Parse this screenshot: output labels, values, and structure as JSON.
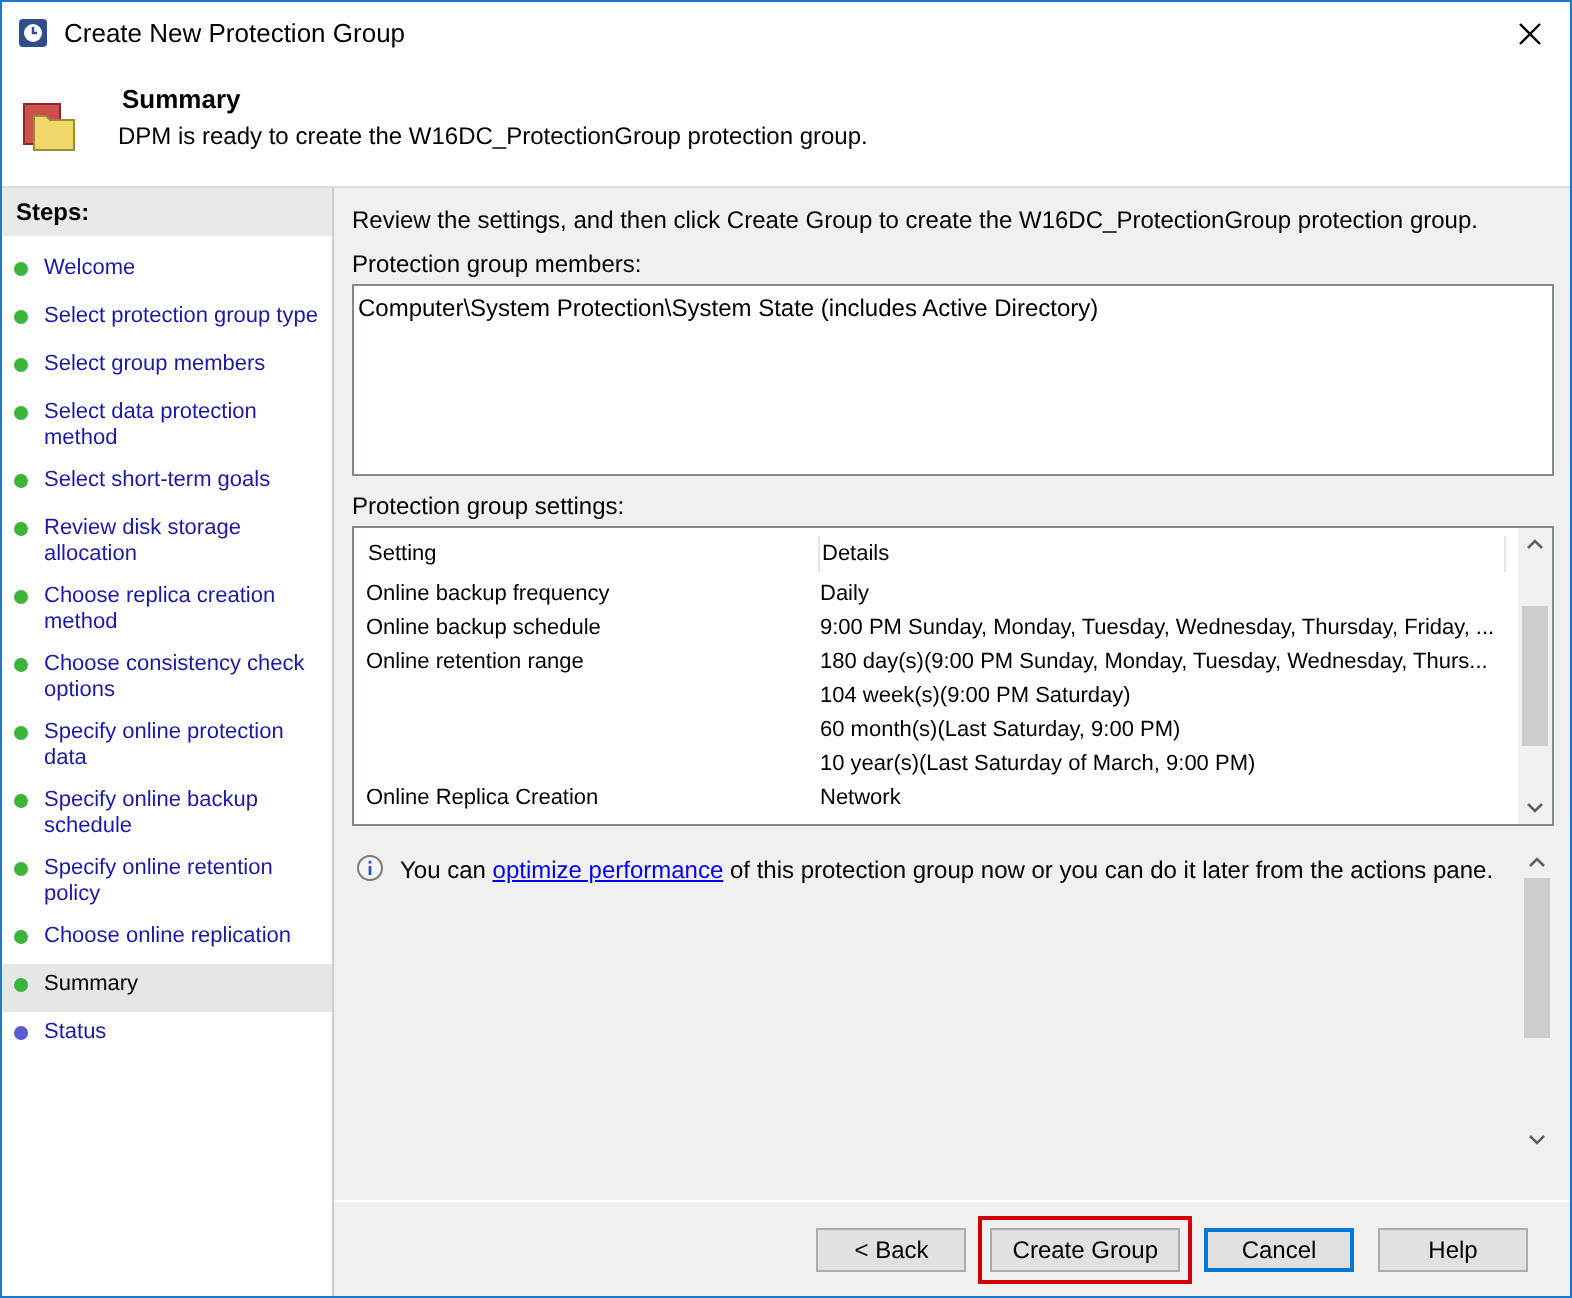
{
  "window": {
    "title": "Create New Protection Group"
  },
  "header": {
    "title": "Summary",
    "subtitle": "DPM is ready to create the W16DC_ProtectionGroup protection group."
  },
  "steps": {
    "title": "Steps:",
    "items": [
      {
        "label": "Welcome",
        "color": "#3cb43c",
        "selected": false
      },
      {
        "label": "Select protection group type",
        "color": "#3cb43c",
        "selected": false
      },
      {
        "label": "Select group members",
        "color": "#3cb43c",
        "selected": false
      },
      {
        "label": "Select data protection method",
        "color": "#3cb43c",
        "selected": false
      },
      {
        "label": "Select short-term goals",
        "color": "#3cb43c",
        "selected": false
      },
      {
        "label": "Review disk storage allocation",
        "color": "#3cb43c",
        "selected": false
      },
      {
        "label": "Choose replica creation method",
        "color": "#3cb43c",
        "selected": false
      },
      {
        "label": "Choose consistency check options",
        "color": "#3cb43c",
        "selected": false
      },
      {
        "label": "Specify online protection data",
        "color": "#3cb43c",
        "selected": false
      },
      {
        "label": "Specify online backup schedule",
        "color": "#3cb43c",
        "selected": false
      },
      {
        "label": "Specify online retention policy",
        "color": "#3cb43c",
        "selected": false
      },
      {
        "label": "Choose online replication",
        "color": "#3cb43c",
        "selected": false
      },
      {
        "label": "Summary",
        "color": "#3cb43c",
        "selected": true
      },
      {
        "label": "Status",
        "color": "#5a5ad2",
        "selected": false
      }
    ]
  },
  "intro": "Review the settings, and then click Create Group to create the W16DC_ProtectionGroup protection group.",
  "members": {
    "label": "Protection group members:",
    "items": [
      "Computer\\System Protection\\System State (includes Active Directory)"
    ]
  },
  "settings": {
    "label": "Protection group settings:",
    "columns": [
      "Setting",
      "Details"
    ],
    "rows": [
      {
        "setting": "Online backup frequency",
        "details": [
          "Daily"
        ]
      },
      {
        "setting": "Online backup schedule",
        "details": [
          "9:00 PM Sunday, Monday, Tuesday, Wednesday, Thursday, Friday, ..."
        ]
      },
      {
        "setting": "Online retention range",
        "details": [
          "180 day(s)(9:00 PM Sunday, Monday, Tuesday, Wednesday, Thurs...",
          "104 week(s)(9:00 PM Saturday)",
          "60 month(s)(Last Saturday, 9:00 PM)",
          "10 year(s)(Last Saturday of March, 9:00 PM)"
        ]
      },
      {
        "setting": "Online Replica Creation",
        "details": [
          "Network"
        ]
      }
    ]
  },
  "info": {
    "before": "You can ",
    "link": "optimize performance",
    "after": " of this protection group now or you can do it later from the actions pane."
  },
  "buttons": [
    {
      "label": "< Back",
      "highlighted": false,
      "default": false
    },
    {
      "label": "Create Group",
      "highlighted": true,
      "default": false
    },
    {
      "label": "Cancel",
      "highlighted": false,
      "default": true
    },
    {
      "label": "Help",
      "highlighted": false,
      "default": false
    }
  ]
}
